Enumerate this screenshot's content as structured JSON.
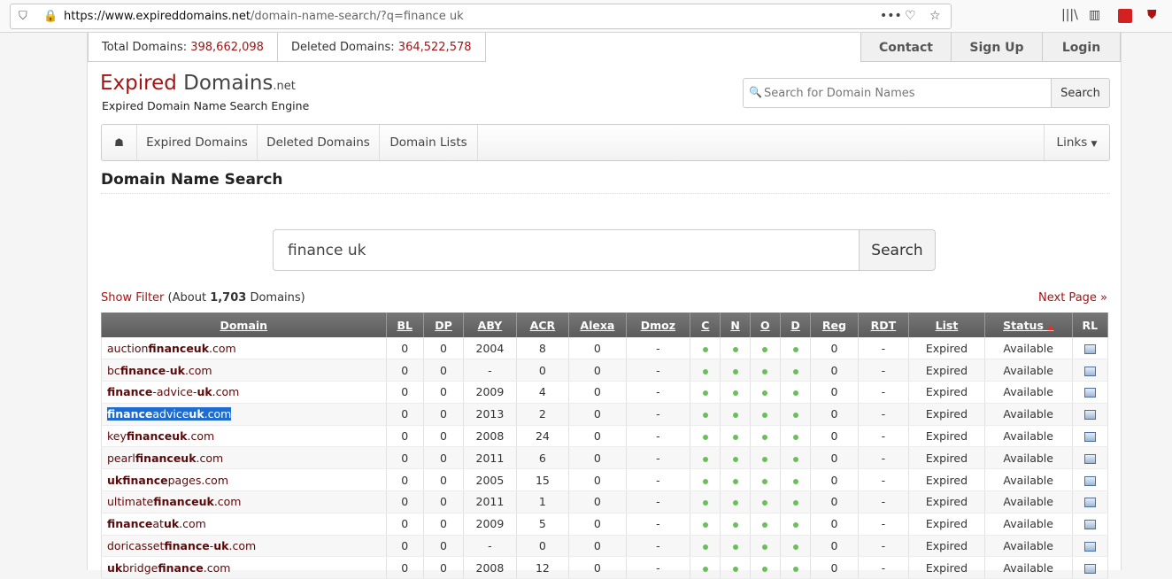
{
  "browser": {
    "url_host": "https://www.expireddomains.net",
    "url_path": "/domain-name-search/?q=finance uk"
  },
  "stats": {
    "total_label": "Total Domains:",
    "total_value": "398,662,098",
    "deleted_label": "Deleted Domains:",
    "deleted_value": "364,522,578"
  },
  "topnav": [
    "Contact",
    "Sign Up",
    "Login"
  ],
  "logo": {
    "part1": "Expired",
    "part2": " Domains",
    "part3": ".net",
    "tagline": "Expired Domain Name Search Engine"
  },
  "header_search": {
    "placeholder": "Search for Domain Names",
    "button": "Search"
  },
  "menu": {
    "items": [
      "Expired Domains",
      "Deleted Domains",
      "Domain Lists"
    ],
    "links": "Links"
  },
  "page_title": "Domain Name Search",
  "main_search": {
    "value": "finance uk",
    "button": "Search"
  },
  "filter": {
    "link": "Show Filter",
    "prefix": "(About ",
    "count": "1,703",
    "suffix": " Domains)"
  },
  "next_page": "Next Page »",
  "table": {
    "headers": [
      "Domain",
      "BL",
      "DP",
      "ABY",
      "ACR",
      "Alexa",
      "Dmoz",
      "C",
      "N",
      "O",
      "D",
      "Reg",
      "RDT",
      "List",
      "Status",
      "RL"
    ],
    "rows": [
      {
        "parts": [
          [
            "auction",
            false
          ],
          [
            "finance",
            true
          ],
          [
            "uk",
            true
          ],
          [
            ".com",
            false
          ]
        ],
        "bl": "0",
        "dp": "0",
        "aby": "2004",
        "acr": "8",
        "alexa": "0",
        "dmoz": "-",
        "reg": "0",
        "rdt": "-",
        "list": "Expired",
        "status": "Available"
      },
      {
        "parts": [
          [
            "bc",
            false
          ],
          [
            "finance",
            true
          ],
          [
            "-",
            false
          ],
          [
            "uk",
            true
          ],
          [
            ".com",
            false
          ]
        ],
        "bl": "0",
        "dp": "0",
        "aby": "-",
        "acr": "0",
        "alexa": "0",
        "dmoz": "-",
        "reg": "0",
        "rdt": "-",
        "list": "Expired",
        "status": "Available"
      },
      {
        "parts": [
          [
            "finance",
            true
          ],
          [
            "-advice-",
            false
          ],
          [
            "uk",
            true
          ],
          [
            ".com",
            false
          ]
        ],
        "bl": "0",
        "dp": "0",
        "aby": "2009",
        "acr": "4",
        "alexa": "0",
        "dmoz": "-",
        "reg": "0",
        "rdt": "-",
        "list": "Expired",
        "status": "Available"
      },
      {
        "parts": [
          [
            "finance",
            true
          ],
          [
            "advice",
            false
          ],
          [
            "uk",
            true
          ],
          [
            ".com",
            false
          ]
        ],
        "bl": "0",
        "dp": "0",
        "aby": "2013",
        "acr": "2",
        "alexa": "0",
        "dmoz": "-",
        "reg": "0",
        "rdt": "-",
        "list": "Expired",
        "status": "Available",
        "selected": true
      },
      {
        "parts": [
          [
            "key",
            false
          ],
          [
            "finance",
            true
          ],
          [
            "uk",
            true
          ],
          [
            ".com",
            false
          ]
        ],
        "bl": "0",
        "dp": "0",
        "aby": "2008",
        "acr": "24",
        "alexa": "0",
        "dmoz": "-",
        "reg": "0",
        "rdt": "-",
        "list": "Expired",
        "status": "Available"
      },
      {
        "parts": [
          [
            "pearl",
            false
          ],
          [
            "finance",
            true
          ],
          [
            "uk",
            true
          ],
          [
            ".com",
            false
          ]
        ],
        "bl": "0",
        "dp": "0",
        "aby": "2011",
        "acr": "6",
        "alexa": "0",
        "dmoz": "-",
        "reg": "0",
        "rdt": "-",
        "list": "Expired",
        "status": "Available"
      },
      {
        "parts": [
          [
            "uk",
            true
          ],
          [
            "finance",
            true
          ],
          [
            "pages.com",
            false
          ]
        ],
        "bl": "0",
        "dp": "0",
        "aby": "2005",
        "acr": "15",
        "alexa": "0",
        "dmoz": "-",
        "reg": "0",
        "rdt": "-",
        "list": "Expired",
        "status": "Available"
      },
      {
        "parts": [
          [
            "ultimate",
            false
          ],
          [
            "finance",
            true
          ],
          [
            "uk",
            true
          ],
          [
            ".com",
            false
          ]
        ],
        "bl": "0",
        "dp": "0",
        "aby": "2011",
        "acr": "1",
        "alexa": "0",
        "dmoz": "-",
        "reg": "0",
        "rdt": "-",
        "list": "Expired",
        "status": "Available"
      },
      {
        "parts": [
          [
            "finance",
            true
          ],
          [
            "at",
            false
          ],
          [
            "uk",
            true
          ],
          [
            ".com",
            false
          ]
        ],
        "bl": "0",
        "dp": "0",
        "aby": "2009",
        "acr": "5",
        "alexa": "0",
        "dmoz": "-",
        "reg": "0",
        "rdt": "-",
        "list": "Expired",
        "status": "Available"
      },
      {
        "parts": [
          [
            "doricasset",
            false
          ],
          [
            "finance",
            true
          ],
          [
            "-",
            false
          ],
          [
            "uk",
            true
          ],
          [
            ".com",
            false
          ]
        ],
        "bl": "0",
        "dp": "0",
        "aby": "-",
        "acr": "0",
        "alexa": "0",
        "dmoz": "-",
        "reg": "0",
        "rdt": "-",
        "list": "Expired",
        "status": "Available"
      },
      {
        "parts": [
          [
            "uk",
            true
          ],
          [
            "bridge",
            false
          ],
          [
            "finance",
            true
          ],
          [
            ".com",
            false
          ]
        ],
        "bl": "0",
        "dp": "0",
        "aby": "2008",
        "acr": "12",
        "alexa": "0",
        "dmoz": "-",
        "reg": "0",
        "rdt": "-",
        "list": "Expired",
        "status": "Available"
      }
    ]
  },
  "colors": {
    "brand": "#a31515",
    "available": "#2c9e2c",
    "selection": "#1e6cd0"
  },
  "icons": {
    "shield": "shield-icon",
    "lock": "lock-icon",
    "menu": "more-icon",
    "pocket": "pocket-icon",
    "star": "bookmark-star-icon",
    "library": "library-icon",
    "sidebar": "sidebar-icon",
    "home": "home-icon",
    "search": "search-icon",
    "rl": "rl-icon"
  }
}
